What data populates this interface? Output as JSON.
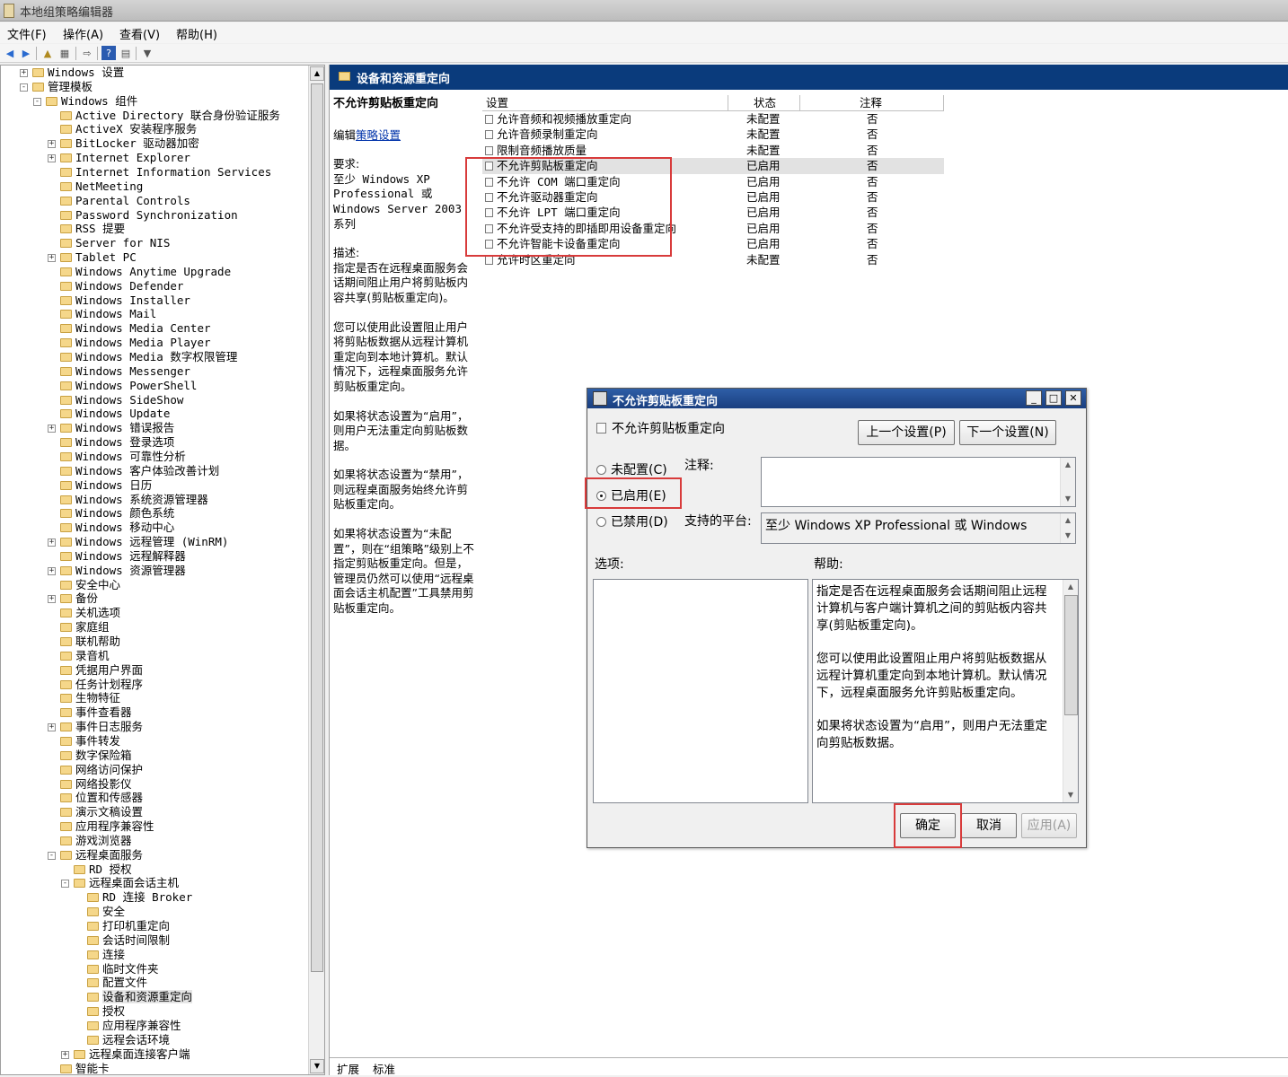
{
  "window": {
    "title": "本地组策略编辑器"
  },
  "menu": [
    "文件(F)",
    "操作(A)",
    "查看(V)",
    "帮助(H)"
  ],
  "tree": [
    {
      "label": "Windows 设置",
      "indent": 1,
      "exp": "+"
    },
    {
      "label": "管理模板",
      "indent": 1,
      "exp": "-"
    },
    {
      "label": "Windows 组件",
      "indent": 2,
      "exp": "-"
    },
    {
      "label": "Active Directory 联合身份验证服务",
      "indent": 3,
      "exp": ""
    },
    {
      "label": "ActiveX 安装程序服务",
      "indent": 3,
      "exp": ""
    },
    {
      "label": "BitLocker 驱动器加密",
      "indent": 3,
      "exp": "+"
    },
    {
      "label": "Internet Explorer",
      "indent": 3,
      "exp": "+"
    },
    {
      "label": "Internet Information Services",
      "indent": 3,
      "exp": ""
    },
    {
      "label": "NetMeeting",
      "indent": 3,
      "exp": ""
    },
    {
      "label": "Parental Controls",
      "indent": 3,
      "exp": ""
    },
    {
      "label": "Password Synchronization",
      "indent": 3,
      "exp": ""
    },
    {
      "label": "RSS 提要",
      "indent": 3,
      "exp": ""
    },
    {
      "label": "Server for NIS",
      "indent": 3,
      "exp": ""
    },
    {
      "label": "Tablet PC",
      "indent": 3,
      "exp": "+"
    },
    {
      "label": "Windows Anytime Upgrade",
      "indent": 3,
      "exp": ""
    },
    {
      "label": "Windows Defender",
      "indent": 3,
      "exp": ""
    },
    {
      "label": "Windows Installer",
      "indent": 3,
      "exp": ""
    },
    {
      "label": "Windows Mail",
      "indent": 3,
      "exp": ""
    },
    {
      "label": "Windows Media Center",
      "indent": 3,
      "exp": ""
    },
    {
      "label": "Windows Media Player",
      "indent": 3,
      "exp": ""
    },
    {
      "label": "Windows Media 数字权限管理",
      "indent": 3,
      "exp": ""
    },
    {
      "label": "Windows Messenger",
      "indent": 3,
      "exp": ""
    },
    {
      "label": "Windows PowerShell",
      "indent": 3,
      "exp": ""
    },
    {
      "label": "Windows SideShow",
      "indent": 3,
      "exp": ""
    },
    {
      "label": "Windows Update",
      "indent": 3,
      "exp": ""
    },
    {
      "label": "Windows 错误报告",
      "indent": 3,
      "exp": "+"
    },
    {
      "label": "Windows 登录选项",
      "indent": 3,
      "exp": ""
    },
    {
      "label": "Windows 可靠性分析",
      "indent": 3,
      "exp": ""
    },
    {
      "label": "Windows 客户体验改善计划",
      "indent": 3,
      "exp": ""
    },
    {
      "label": "Windows 日历",
      "indent": 3,
      "exp": ""
    },
    {
      "label": "Windows 系统资源管理器",
      "indent": 3,
      "exp": ""
    },
    {
      "label": "Windows 颜色系统",
      "indent": 3,
      "exp": ""
    },
    {
      "label": "Windows 移动中心",
      "indent": 3,
      "exp": ""
    },
    {
      "label": "Windows 远程管理 (WinRM)",
      "indent": 3,
      "exp": "+"
    },
    {
      "label": "Windows 远程解释器",
      "indent": 3,
      "exp": ""
    },
    {
      "label": "Windows 资源管理器",
      "indent": 3,
      "exp": "+"
    },
    {
      "label": "安全中心",
      "indent": 3,
      "exp": ""
    },
    {
      "label": "备份",
      "indent": 3,
      "exp": "+"
    },
    {
      "label": "关机选项",
      "indent": 3,
      "exp": ""
    },
    {
      "label": "家庭组",
      "indent": 3,
      "exp": ""
    },
    {
      "label": "联机帮助",
      "indent": 3,
      "exp": ""
    },
    {
      "label": "录音机",
      "indent": 3,
      "exp": ""
    },
    {
      "label": "凭据用户界面",
      "indent": 3,
      "exp": ""
    },
    {
      "label": "任务计划程序",
      "indent": 3,
      "exp": ""
    },
    {
      "label": "生物特征",
      "indent": 3,
      "exp": ""
    },
    {
      "label": "事件查看器",
      "indent": 3,
      "exp": ""
    },
    {
      "label": "事件日志服务",
      "indent": 3,
      "exp": "+"
    },
    {
      "label": "事件转发",
      "indent": 3,
      "exp": ""
    },
    {
      "label": "数字保险箱",
      "indent": 3,
      "exp": ""
    },
    {
      "label": "网络访问保护",
      "indent": 3,
      "exp": ""
    },
    {
      "label": "网络投影仪",
      "indent": 3,
      "exp": ""
    },
    {
      "label": "位置和传感器",
      "indent": 3,
      "exp": ""
    },
    {
      "label": "演示文稿设置",
      "indent": 3,
      "exp": ""
    },
    {
      "label": "应用程序兼容性",
      "indent": 3,
      "exp": ""
    },
    {
      "label": "游戏浏览器",
      "indent": 3,
      "exp": ""
    },
    {
      "label": "远程桌面服务",
      "indent": 3,
      "exp": "-"
    },
    {
      "label": "RD 授权",
      "indent": 4,
      "exp": ""
    },
    {
      "label": "远程桌面会话主机",
      "indent": 4,
      "exp": "-"
    },
    {
      "label": "RD 连接 Broker",
      "indent": 5,
      "exp": ""
    },
    {
      "label": "安全",
      "indent": 5,
      "exp": ""
    },
    {
      "label": "打印机重定向",
      "indent": 5,
      "exp": ""
    },
    {
      "label": "会话时间限制",
      "indent": 5,
      "exp": ""
    },
    {
      "label": "连接",
      "indent": 5,
      "exp": ""
    },
    {
      "label": "临时文件夹",
      "indent": 5,
      "exp": ""
    },
    {
      "label": "配置文件",
      "indent": 5,
      "exp": ""
    },
    {
      "label": "设备和资源重定向",
      "indent": 5,
      "exp": "",
      "selected": true
    },
    {
      "label": "授权",
      "indent": 5,
      "exp": ""
    },
    {
      "label": "应用程序兼容性",
      "indent": 5,
      "exp": ""
    },
    {
      "label": "远程会话环境",
      "indent": 5,
      "exp": ""
    },
    {
      "label": "远程桌面连接客户端",
      "indent": 4,
      "exp": "+"
    },
    {
      "label": "智能卡",
      "indent": 3,
      "exp": ""
    }
  ],
  "right": {
    "header": "设备和资源重定向",
    "desc": {
      "title": "不允许剪贴板重定向",
      "edit_prefix": "编辑",
      "edit_link": "策略设置",
      "req_label": "要求:",
      "req_text": "至少 Windows XP Professional 或 Windows Server 2003 系列",
      "desc_label": "描述:",
      "paras": [
        "指定是否在远程桌面服务会话期间阻止用户将剪贴板内容共享(剪贴板重定向)。",
        "您可以使用此设置阻止用户将剪贴板数据从远程计算机重定向到本地计算机。默认情况下，远程桌面服务允许剪贴板重定向。",
        "如果将状态设置为“启用”，则用户无法重定向剪贴板数据。",
        "如果将状态设置为“禁用”，则远程桌面服务始终允许剪贴板重定向。",
        "如果将状态设置为“未配置”，则在“组策略”级别上不指定剪贴板重定向。但是，管理员仍然可以使用“远程桌面会话主机配置”工具禁用剪贴板重定向。"
      ]
    },
    "grid": {
      "headers": [
        "设置",
        "状态",
        "注释"
      ],
      "rows": [
        {
          "setting": "允许音频和视频播放重定向",
          "state": "未配置",
          "note": "否"
        },
        {
          "setting": "允许音频录制重定向",
          "state": "未配置",
          "note": "否"
        },
        {
          "setting": "限制音频播放质量",
          "state": "未配置",
          "note": "否"
        },
        {
          "setting": "不允许剪贴板重定向",
          "state": "已启用",
          "note": "否",
          "selected": true
        },
        {
          "setting": "不允许 COM 端口重定向",
          "state": "已启用",
          "note": "否"
        },
        {
          "setting": "不允许驱动器重定向",
          "state": "已启用",
          "note": "否"
        },
        {
          "setting": "不允许 LPT 端口重定向",
          "state": "已启用",
          "note": "否"
        },
        {
          "setting": "不允许受支持的即插即用设备重定向",
          "state": "已启用",
          "note": "否"
        },
        {
          "setting": "不允许智能卡设备重定向",
          "state": "已启用",
          "note": "否"
        },
        {
          "setting": "允许时区重定向",
          "state": "未配置",
          "note": "否"
        }
      ]
    },
    "tabs": [
      "扩展",
      "标准"
    ]
  },
  "dialog": {
    "title": "不允许剪贴板重定向",
    "subtitle": "不允许剪贴板重定向",
    "prev": "上一个设置(P)",
    "next": "下一个设置(N)",
    "radio_not_configured": "未配置(C)",
    "radio_enabled": "已启用(E)",
    "radio_disabled": "已禁用(D)",
    "comment_label": "注释:",
    "platform_label": "支持的平台:",
    "platform_value": "至少 Windows XP Professional 或 Windows",
    "options_label": "选项:",
    "help_label": "帮助:",
    "help_paras": [
      "指定是否在远程桌面服务会话期间阻止远程计算机与客户端计算机之间的剪贴板内容共享(剪贴板重定向)。",
      "您可以使用此设置阻止用户将剪贴板数据从远程计算机重定向到本地计算机。默认情况下，远程桌面服务允许剪贴板重定向。",
      "如果将状态设置为“启用”，则用户无法重定向剪贴板数据。"
    ],
    "ok": "确定",
    "cancel": "取消",
    "apply": "应用(A)"
  }
}
